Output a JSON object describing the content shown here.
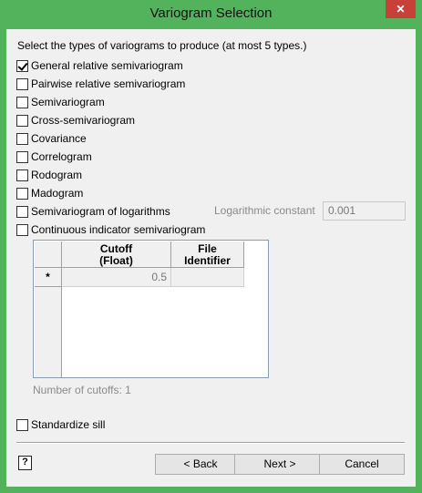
{
  "window": {
    "title": "Variogram Selection",
    "close_glyph": "✕"
  },
  "instructions": "Select the types of variograms to produce (at most 5 types.)",
  "variogram_types": [
    {
      "label": "General relative semivariogram",
      "checked": true
    },
    {
      "label": "Pairwise relative semivariogram",
      "checked": false
    },
    {
      "label": "Semivariogram",
      "checked": false
    },
    {
      "label": "Cross-semivariogram",
      "checked": false
    },
    {
      "label": "Covariance",
      "checked": false
    },
    {
      "label": "Correlogram",
      "checked": false
    },
    {
      "label": "Rodogram",
      "checked": false
    },
    {
      "label": "Madogram",
      "checked": false
    },
    {
      "label": "Semivariogram of logarithms",
      "checked": false
    },
    {
      "label": "Continuous indicator semivariogram",
      "checked": false
    }
  ],
  "log_constant": {
    "label": "Logarithmic constant",
    "value": "0.001"
  },
  "cutoff_table": {
    "columns": [
      "Cutoff\n(Float)",
      "File\nIdentifier"
    ],
    "rows": [
      {
        "marker": "*",
        "cutoff": "0.5",
        "file_identifier": ""
      }
    ]
  },
  "cutoff_count": "Number of cutoffs: 1",
  "standardize_sill": {
    "label": "Standardize sill",
    "checked": false
  },
  "help_glyph": "?",
  "buttons": {
    "back": "< Back",
    "next": "Next >",
    "cancel": "Cancel"
  }
}
